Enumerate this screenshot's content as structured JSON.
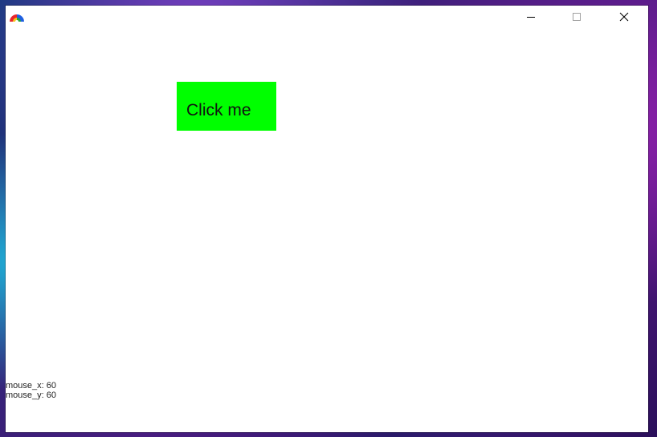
{
  "window": {
    "title": "",
    "icon": "rainbow-arc-icon",
    "controls": {
      "minimize_icon": "minimize-icon",
      "maximize_icon": "maximize-icon",
      "close_icon": "close-icon"
    }
  },
  "main": {
    "button_label": "Click me",
    "button_color": "#00ff00"
  },
  "debug": {
    "mouse_x_label": "mouse_x: 60",
    "mouse_y_label": "mouse_y: 60"
  }
}
